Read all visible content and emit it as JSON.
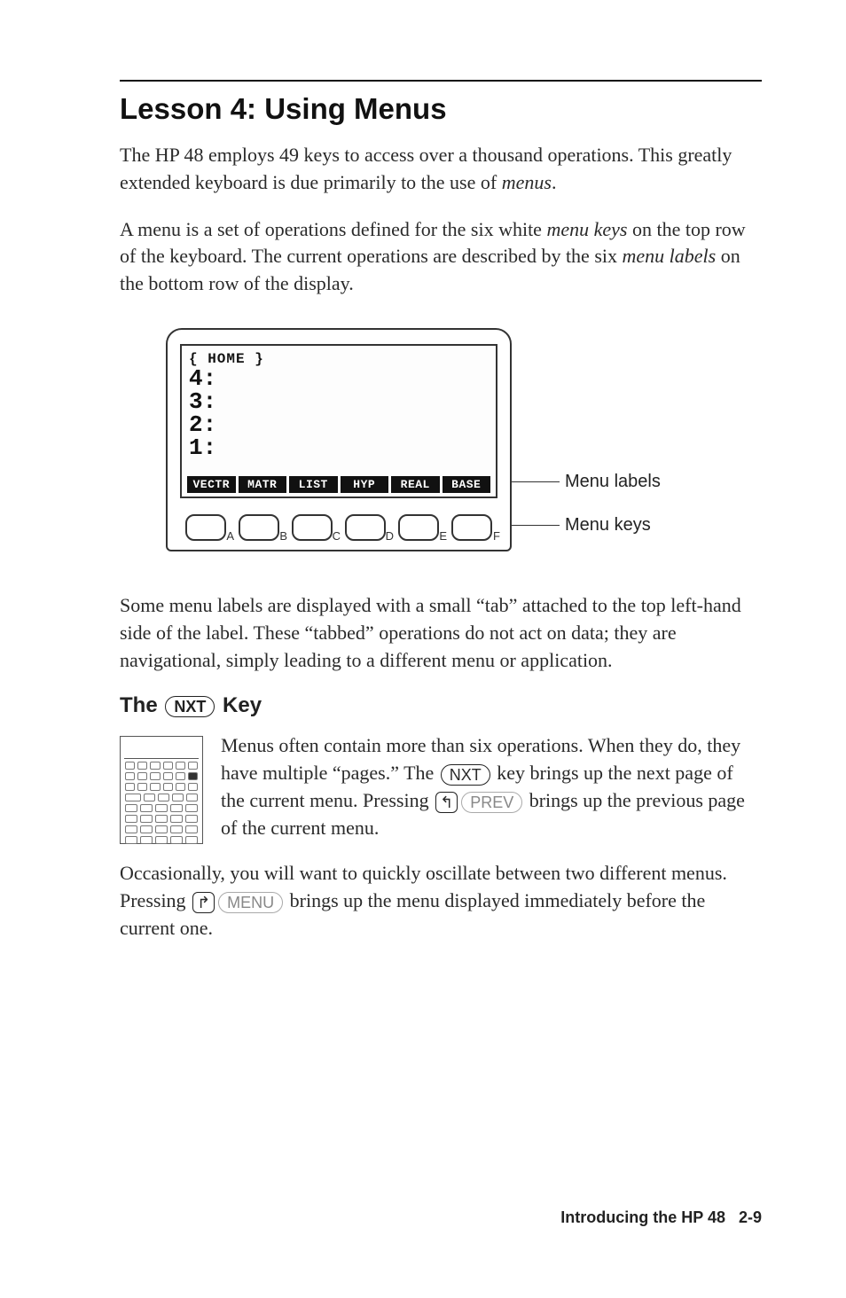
{
  "title": "Lesson 4: Using Menus",
  "para1a": "The HP 48 employs 49 keys to access over a thousand operations. This greatly extended keyboard is due primarily to the use of ",
  "para1b": "menus",
  "para1c": ".",
  "para2a": "A menu is a set of operations defined for the six white ",
  "para2b": "menu keys",
  "para2c": " on the top row of the keyboard. The current operations are described by the six ",
  "para2d": "menu labels",
  "para2e": " on the bottom row of the display.",
  "screen": {
    "path": "{ HOME }",
    "stack": [
      "4:",
      "3:",
      "2:",
      "1:"
    ],
    "labels": [
      "VECTR",
      "MATR",
      "LIST",
      "HYP",
      "REAL",
      "BASE"
    ],
    "keyletters": [
      "A",
      "B",
      "C",
      "D",
      "E",
      "F"
    ]
  },
  "annot_labels": "Menu labels",
  "annot_keys": "Menu keys",
  "para3": "Some menu labels are displayed with a small “tab” attached to the top left-hand side of the label. These “tabbed” operations do not act on data; they are navigational, simply leading to a different menu or application.",
  "sub_a": "The ",
  "sub_key": "NXT",
  "sub_b": " Key",
  "para4a": "Menus often contain more than six operations. When they do, they have multiple “pages.” The ",
  "para4_key1": "NXT",
  "para4b": " key brings up the next page of the current menu. Pressing ",
  "para4_shiftL": "↰",
  "para4_key2": "PREV",
  "para4c": " brings up the previous page of the current menu.",
  "para5a": "Occasionally, you will want to quickly oscillate between two different menus. Pressing ",
  "para5_shiftR": "↱",
  "para5_key": "MENU",
  "para5b": " brings up the menu displayed immediately before the current one.",
  "footer_a": "Introducing the HP 48",
  "footer_b": "2-9"
}
